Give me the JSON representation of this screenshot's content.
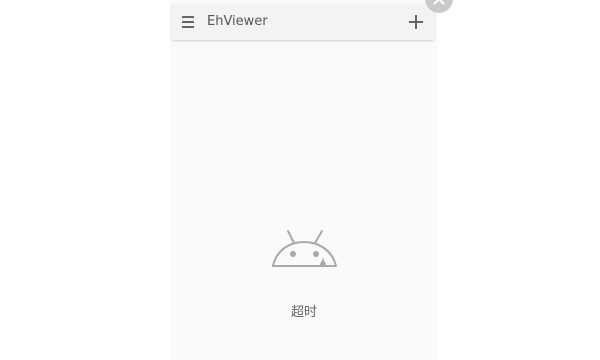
{
  "app": {
    "title": "EhViewer"
  },
  "toolbar": {
    "menu_icon": "menu-icon",
    "add_icon": "plus-icon"
  },
  "overlay": {
    "close_icon": "close-icon"
  },
  "empty_state": {
    "icon": "android-error-icon",
    "message": "超时"
  },
  "colors": {
    "screen_background": "#fafafa",
    "appbar_background": "#f3f3f3",
    "icon_gray": "#666666"
  }
}
